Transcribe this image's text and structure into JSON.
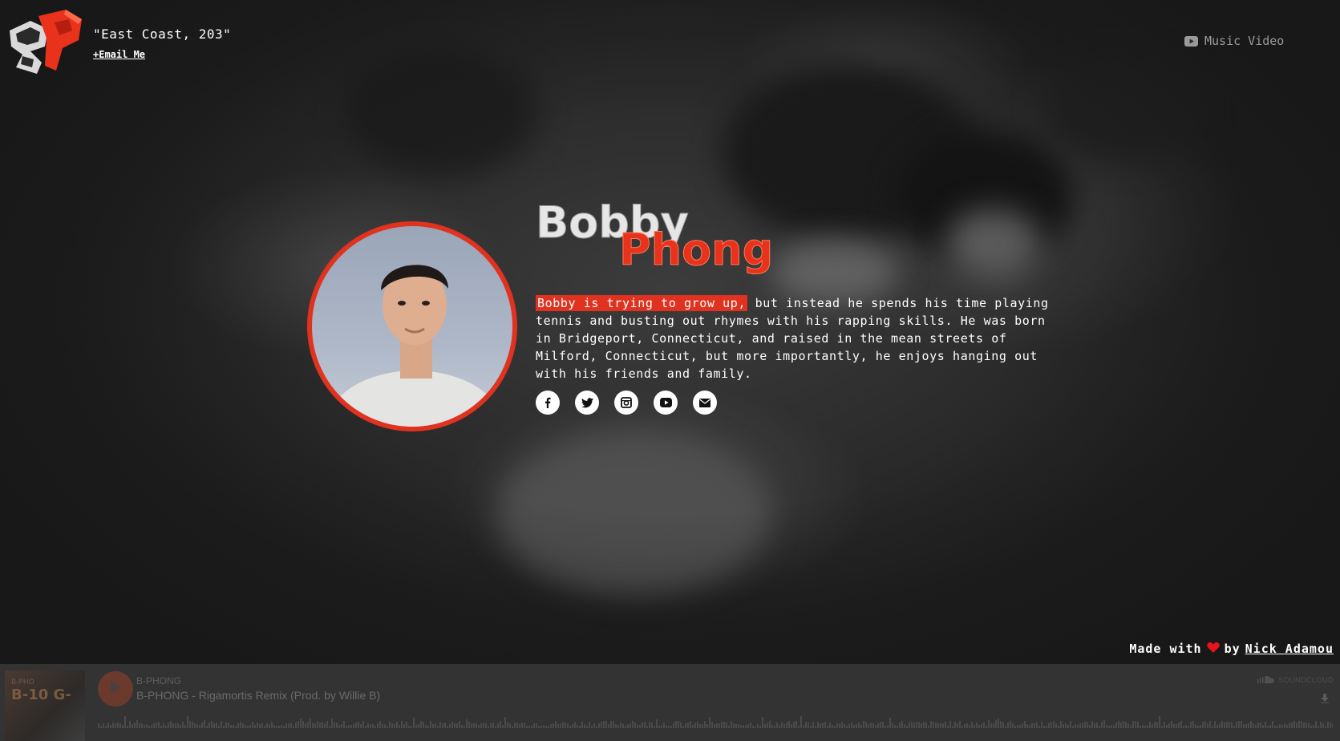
{
  "header": {
    "tagline": "\"East Coast, 203\"",
    "email_link": "+Email Me",
    "music_video": "Music Video"
  },
  "profile": {
    "first_name": "Bobby",
    "last_name": "Phong",
    "bio_highlight": "Bobby is trying to grow up,",
    "bio_rest": " but instead he spends his time playing tennis and busting out rhymes with his rapping skills. He was born in Bridgeport, Connecticut, and raised in the mean streets of Milford, Connecticut, but more importantly, he enjoys hanging out with his friends and family.",
    "socials": [
      "facebook-icon",
      "twitter-icon",
      "instagram-icon",
      "youtube-icon",
      "envelope-icon"
    ]
  },
  "footer": {
    "made_with": "Made with",
    "by": "by",
    "author": "Nick Adamou"
  },
  "player": {
    "artist": "B-PHONG",
    "track": "B-PHONG - Rigamortis Remix (Prod. by Willie B)",
    "brand": "SOUNDCLOUD",
    "artwork_text": "B-10 G-",
    "artwork_small": "B-PHO"
  },
  "colors": {
    "accent": "#e0321f",
    "background": "#2b2b2b",
    "player_bg": "#333333"
  }
}
